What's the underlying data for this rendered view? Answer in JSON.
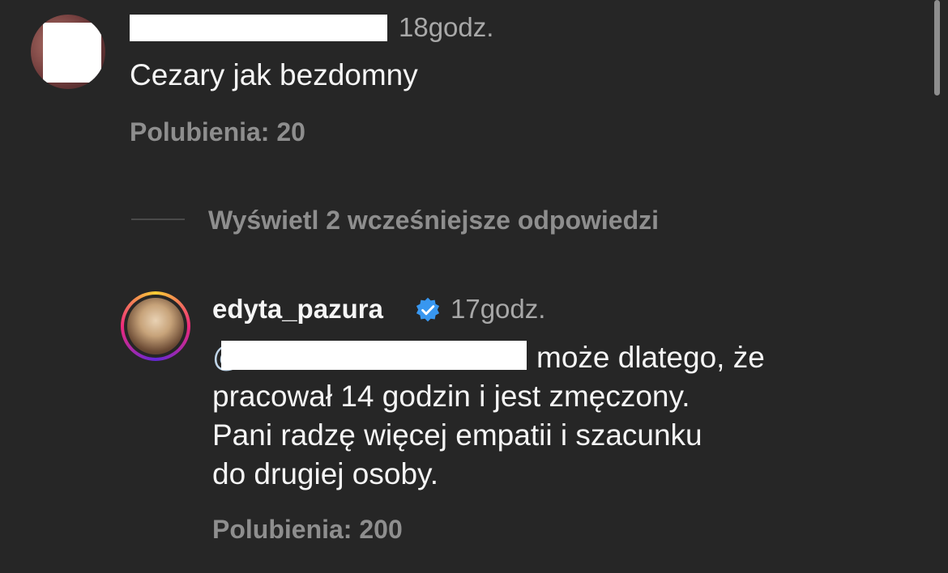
{
  "comment1": {
    "avatar": "user-avatar-redacted",
    "time": "18godz.",
    "text": "Cezary jak bezdomny",
    "likes": "Polubienia: 20"
  },
  "view_replies": {
    "label": "Wyświetl 2 wcześniejsze odpowiedzi"
  },
  "comment2": {
    "username": "edyta_pazura",
    "verified_icon": "verified-badge-icon",
    "verified_color": "#3897f0",
    "time": "17godz.",
    "mention_prefix": "@",
    "text_lines": [
      "może dlatego, że",
      "pracował 14 godzin i jest zmęczony.",
      "Pani radzę więcej empatii i szacunku",
      "do drugiej osoby."
    ],
    "likes": "Polubienia: 200"
  },
  "colors": {
    "background": "#262626",
    "primary_text": "#f5f5f5",
    "secondary_text": "#8e8e8e"
  }
}
